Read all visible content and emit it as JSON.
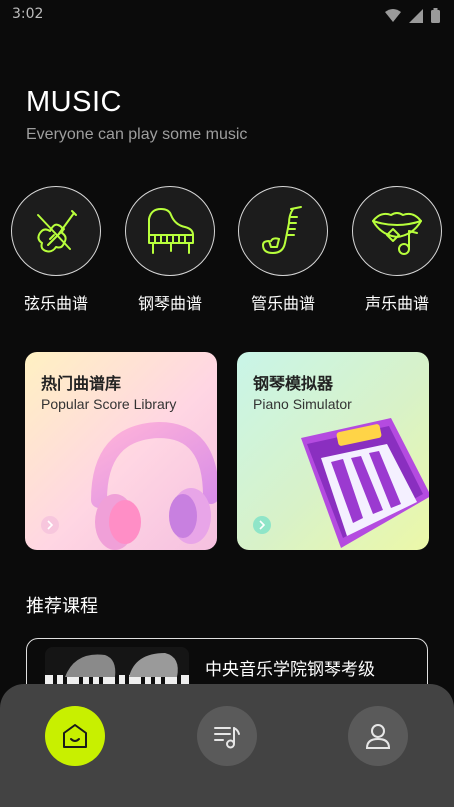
{
  "status": {
    "time": "3:02"
  },
  "header": {
    "title": "MUSIC",
    "subtitle": "Everyone can play some music"
  },
  "categories": [
    {
      "label": "弦乐曲谱",
      "icon": "violin-icon"
    },
    {
      "label": "钢琴曲谱",
      "icon": "grand-piano-icon"
    },
    {
      "label": "管乐曲谱",
      "icon": "saxophone-icon"
    },
    {
      "label": "声乐曲谱",
      "icon": "lips-music-icon"
    }
  ],
  "features": [
    {
      "title": "热门曲谱库",
      "subtitle": "Popular Score Library",
      "icon": "headphones-icon"
    },
    {
      "title": "钢琴模拟器",
      "subtitle": "Piano Simulator",
      "icon": "keyboard-icon"
    }
  ],
  "recommend": {
    "section_title": "推荐课程",
    "courses": [
      {
        "title": "中央音乐学院钢琴考级"
      }
    ]
  },
  "tabbar": {
    "tabs": [
      {
        "name": "home",
        "icon": "home-icon",
        "active": true
      },
      {
        "name": "scores",
        "icon": "playlist-music-icon",
        "active": false
      },
      {
        "name": "profile",
        "icon": "user-icon",
        "active": false
      }
    ]
  },
  "colors": {
    "accent": "#c8f000",
    "icon_green": "#b8ff3c",
    "background": "#0b0b0b",
    "tabbar": "#434343"
  }
}
